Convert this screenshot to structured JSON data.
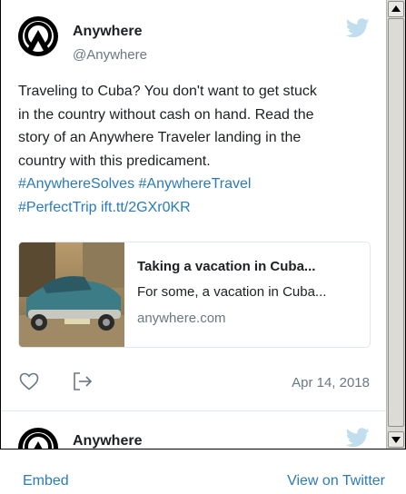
{
  "tweets": [
    {
      "name": "Anywhere",
      "handle": "@Anywhere",
      "text_lines": [
        "Traveling to Cuba? You don't want to get stuck",
        "in the country without cash on hand. Read the",
        "story of an Anywhere Traveler landing in the",
        "country with this predicament."
      ],
      "link_lines": [
        "#AnywhereSolves #AnywhereTravel",
        "#PerfectTrip ift.tt/2GXr0KR"
      ],
      "card": {
        "title": "Taking a vacation in Cuba...",
        "description": "For some, a vacation in Cuba...",
        "domain": "anywhere.com",
        "image_icon": "vintage-car-photo"
      },
      "date": "Apr 14, 2018",
      "icons": [
        "heart-icon",
        "share-icon",
        "twitter-bird-icon"
      ]
    },
    {
      "name": "Anywhere"
    }
  ],
  "footer": {
    "embed_label": "Embed",
    "view_label": "View on Twitter"
  },
  "colors": {
    "link": "#2b7bb9",
    "muted": "#697882",
    "bird": "#c0deed",
    "text": "#1c2022"
  }
}
